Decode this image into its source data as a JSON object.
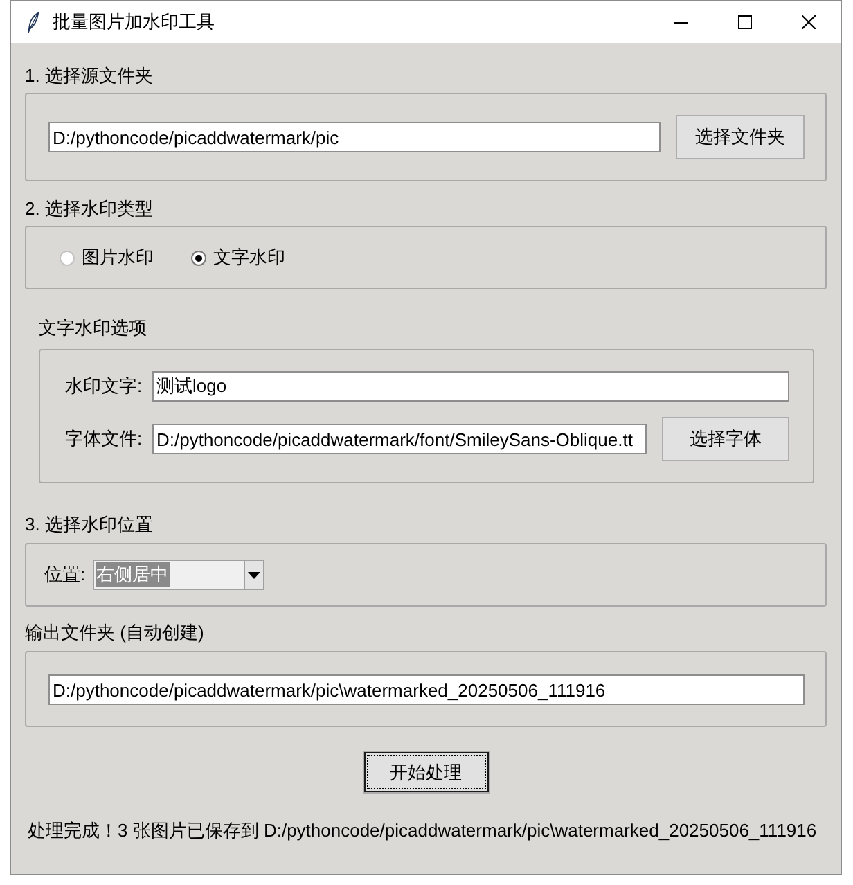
{
  "window": {
    "title": "批量图片加水印工具"
  },
  "source": {
    "label": "1. 选择源文件夹",
    "path": "D:/pythoncode/picaddwatermark/pic",
    "button": "选择文件夹"
  },
  "watermark_type": {
    "label": "2. 选择水印类型",
    "options": [
      {
        "label": "图片水印",
        "selected": false
      },
      {
        "label": "文字水印",
        "selected": true
      }
    ]
  },
  "text_options": {
    "label": "文字水印选项",
    "fields": [
      {
        "label": "水印文字:",
        "value": "测试logo"
      },
      {
        "label": "字体文件:",
        "value": "D:/pythoncode/picaddwatermark/font/SmileySans-Oblique.tt",
        "button": "选择字体"
      }
    ]
  },
  "position": {
    "label": "3. 选择水印位置",
    "field_label": "位置:",
    "value": "右侧居中",
    "highlighted": true
  },
  "output": {
    "label": "输出文件夹 (自动创建)",
    "path": "D:/pythoncode/picaddwatermark/pic\\watermarked_20250506_111916"
  },
  "start_button": {
    "label": "开始处理",
    "focused": true
  },
  "status": "处理完成！3 张图片已保存到 D:/pythoncode/picaddwatermark/pic\\watermarked_20250506_111916"
}
